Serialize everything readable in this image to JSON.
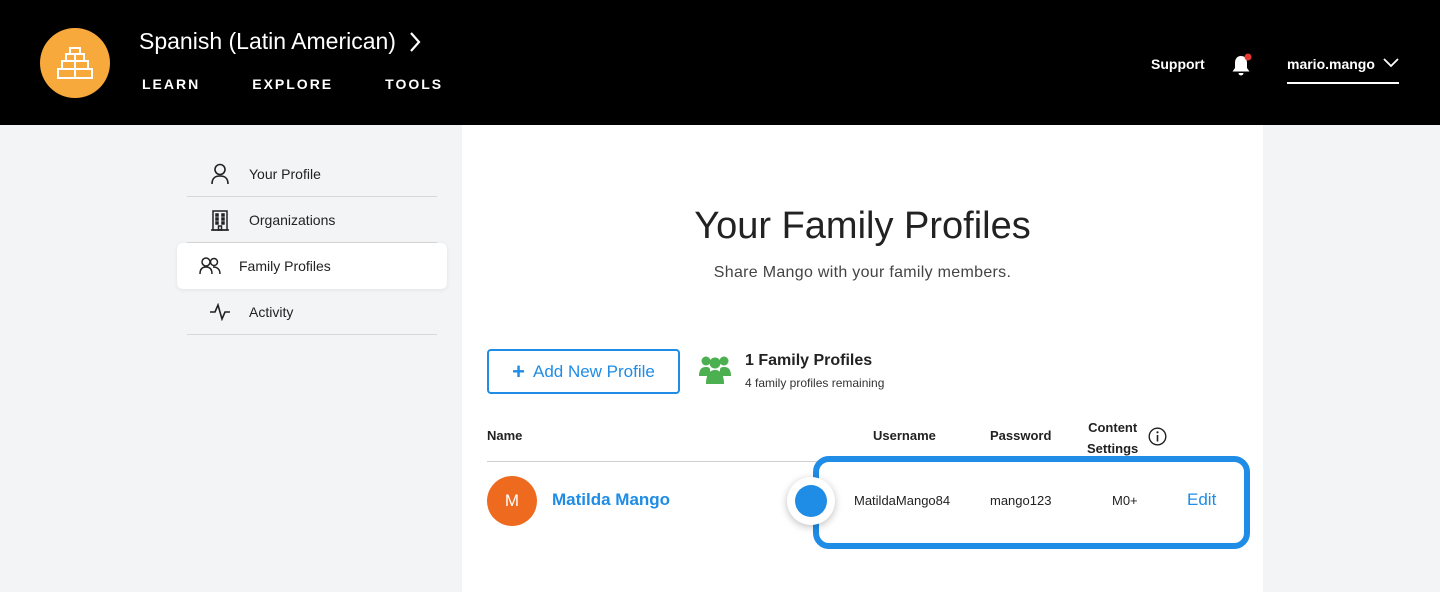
{
  "header": {
    "course_title": "Spanish (Latin American)",
    "nav": [
      "LEARN",
      "EXPLORE",
      "TOOLS"
    ],
    "support_label": "Support",
    "username": "mario.mango",
    "logo_icon": "pyramid-icon",
    "notification_dot_color": "#e53935"
  },
  "sidebar": {
    "items": [
      {
        "label": "Your Profile",
        "icon": "person-icon",
        "active": false
      },
      {
        "label": "Organizations",
        "icon": "building-icon",
        "active": false
      },
      {
        "label": "Family Profiles",
        "icon": "people-icon",
        "active": true
      },
      {
        "label": "Activity",
        "icon": "activity-icon",
        "active": false
      }
    ]
  },
  "main": {
    "title": "Your Family Profiles",
    "subtitle": "Share Mango with your family members.",
    "add_button_label": "Add New Profile",
    "family_count": "1 Family Profiles",
    "family_remaining": "4 family profiles remaining",
    "table": {
      "headers": {
        "name": "Name",
        "username": "Username",
        "password": "Password",
        "content_line1": "Content",
        "content_line2": "Settings"
      },
      "rows": [
        {
          "initial": "M",
          "name": "Matilda Mango",
          "username": "MatildaMango84",
          "password": "mango123",
          "content": "M0+",
          "action": "Edit"
        }
      ]
    }
  },
  "colors": {
    "accent": "#1f8ce5",
    "logo": "#f7a93b",
    "avatar": "#ee6a1f",
    "family_icon": "#4caf50"
  }
}
